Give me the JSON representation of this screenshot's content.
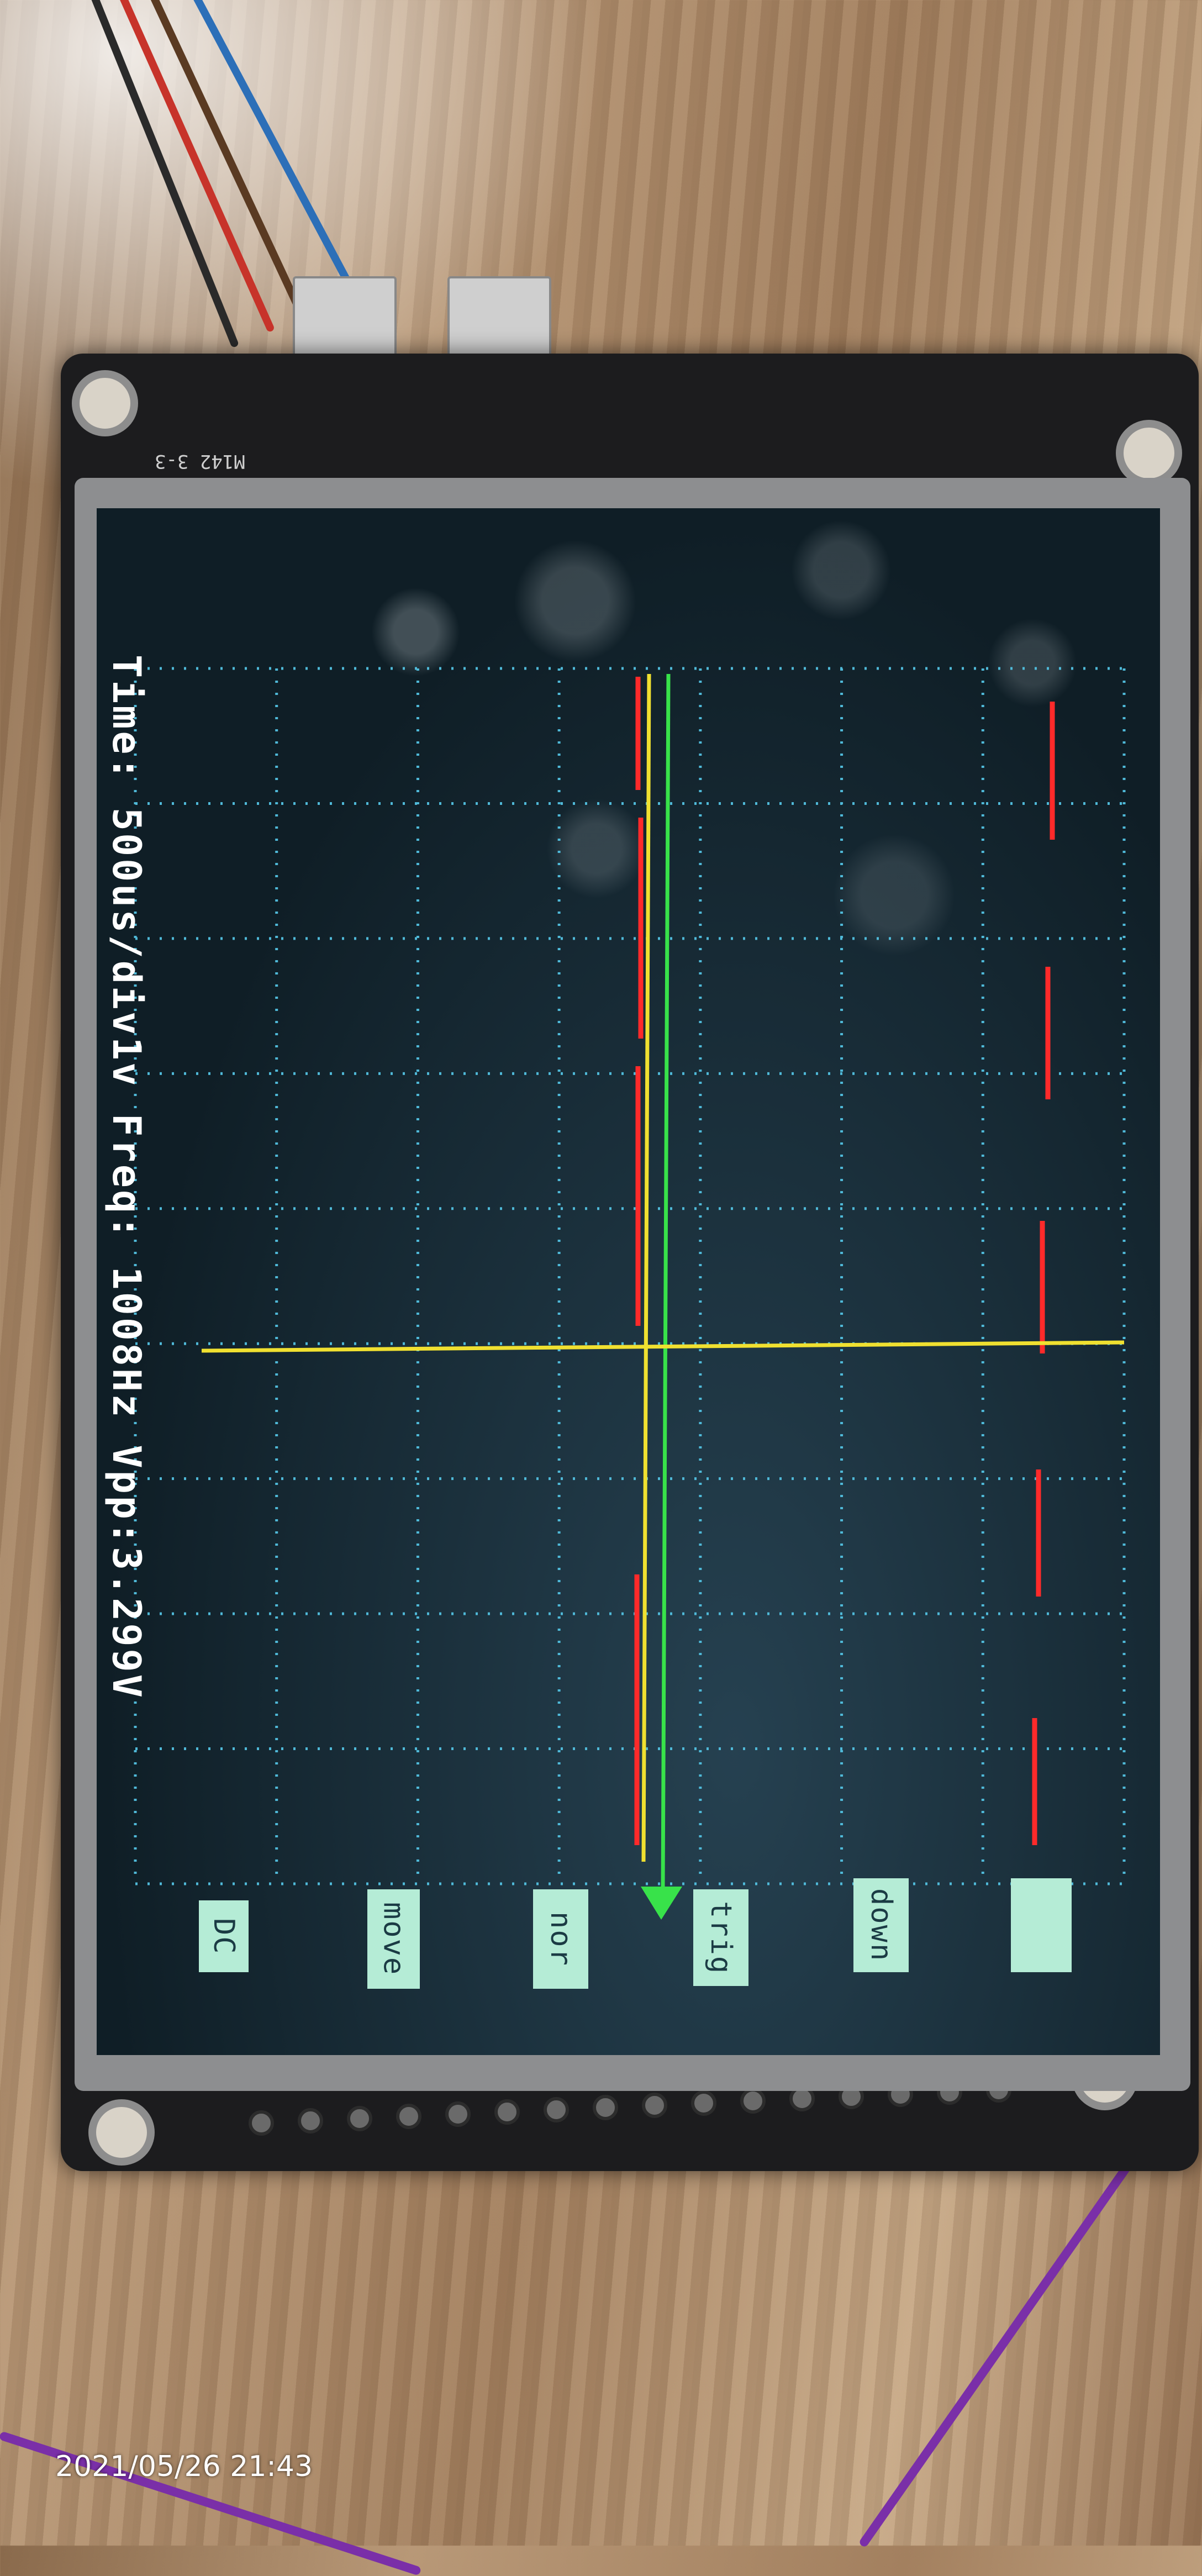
{
  "board": {
    "silkscreen_label": "M142 3-3"
  },
  "scope": {
    "status_line": "Time: 500us/div1v Freq: 1008Hz Vpp:3.299V",
    "buttons": [
      {
        "label": "DC"
      },
      {
        "label": "move"
      },
      {
        "label": "nor"
      },
      {
        "label": "trig"
      },
      {
        "label": "down"
      },
      {
        "label": ""
      }
    ]
  },
  "colors": {
    "grid_dots": "#4fb9d8",
    "signal_trace": "#ff2a2a",
    "trigger_level_line": "#f0e030",
    "cursor_line": "#38e24a",
    "button_fill": "#b5ecd6"
  },
  "photo": {
    "timestamp": "2021/05/26 21:43"
  }
}
